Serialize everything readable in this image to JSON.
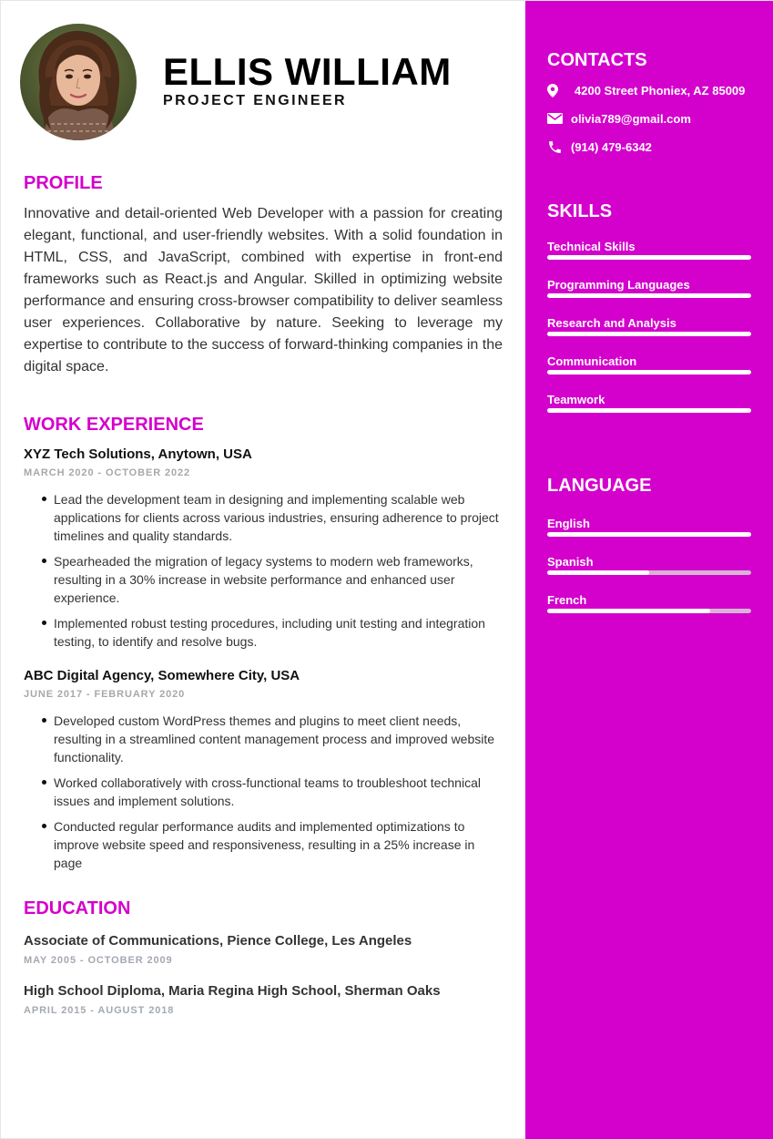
{
  "header": {
    "name": "ELLIS WILLIAM",
    "title": "PROJECT ENGINEER"
  },
  "profile": {
    "heading": "PROFILE",
    "text": "Innovative and detail-oriented Web Developer with a passion for creating elegant, functional, and user-friendly websites. With a solid foundation in HTML, CSS, and JavaScript, combined with expertise in front-end frameworks such as React.js and Angular. Skilled in optimizing website performance and ensuring cross-browser compatibility to deliver seamless user experiences. Collaborative by nature. Seeking to leverage my expertise to contribute to the success of forward-thinking companies in the digital space."
  },
  "experience": {
    "heading": "WORK EXPERIENCE",
    "jobs": [
      {
        "title": "XYZ Tech Solutions, Anytown, USA",
        "date": "MARCH 2020 - OCTOBER 2022",
        "bullets": [
          "Lead the development team in designing and implementing scalable web applications for clients across various industries, ensuring adherence to project timelines and quality standards.",
          "Spearheaded the migration of legacy systems to modern web frameworks, resulting in a 30% increase in website performance and enhanced user experience.",
          "Implemented robust testing procedures, including unit testing and integration testing, to identify and resolve bugs."
        ]
      },
      {
        "title": "ABC Digital Agency, Somewhere City, USA",
        "date": "JUNE 2017 - FEBRUARY 2020",
        "bullets": [
          "Developed custom WordPress themes and plugins to meet client needs, resulting in a streamlined content management process and improved website functionality.",
          "Worked collaboratively with cross-functional teams to troubleshoot technical issues and implement solutions.",
          "Conducted regular performance audits and implemented optimizations to improve website speed and responsiveness, resulting in a 25% increase in page"
        ]
      }
    ]
  },
  "education": {
    "heading": "EDUCATION",
    "items": [
      {
        "title": "Associate of Communications, Pience College, Les Angeles",
        "date": "MAY 2005 - OCTOBER 2009"
      },
      {
        "title": "High School Diploma, Maria Regina High School, Sherman Oaks",
        "date": "APRIL 2015 - AUGUST 2018"
      }
    ]
  },
  "contacts": {
    "heading": "CONTACTS",
    "address": "4200 Street Phoniex, AZ 85009",
    "email": "olivia789@gmail.com",
    "phone": "(914) 479-6342",
    "icons": [
      "location-pin-icon",
      "envelope-icon",
      "phone-icon"
    ]
  },
  "skills": {
    "heading": "SKILLS",
    "items": [
      {
        "label": "Technical Skills",
        "level": 1.0
      },
      {
        "label": "Programming Languages",
        "level": 1.0
      },
      {
        "label": "Research and Analysis",
        "level": 1.0
      },
      {
        "label": "Communication",
        "level": 1.0
      },
      {
        "label": "Teamwork",
        "level": 1.0
      }
    ]
  },
  "languages": {
    "heading": "LANGUAGE",
    "items": [
      {
        "label": "English",
        "level": 1.0
      },
      {
        "label": "Spanish",
        "level": 0.5
      },
      {
        "label": "French",
        "level": 0.8
      }
    ]
  },
  "colors": {
    "accent": "#d400cc",
    "sidebar_text": "#ffffff",
    "bar_track": "#d7b3d6",
    "date_gray": "#a8a8a8"
  }
}
